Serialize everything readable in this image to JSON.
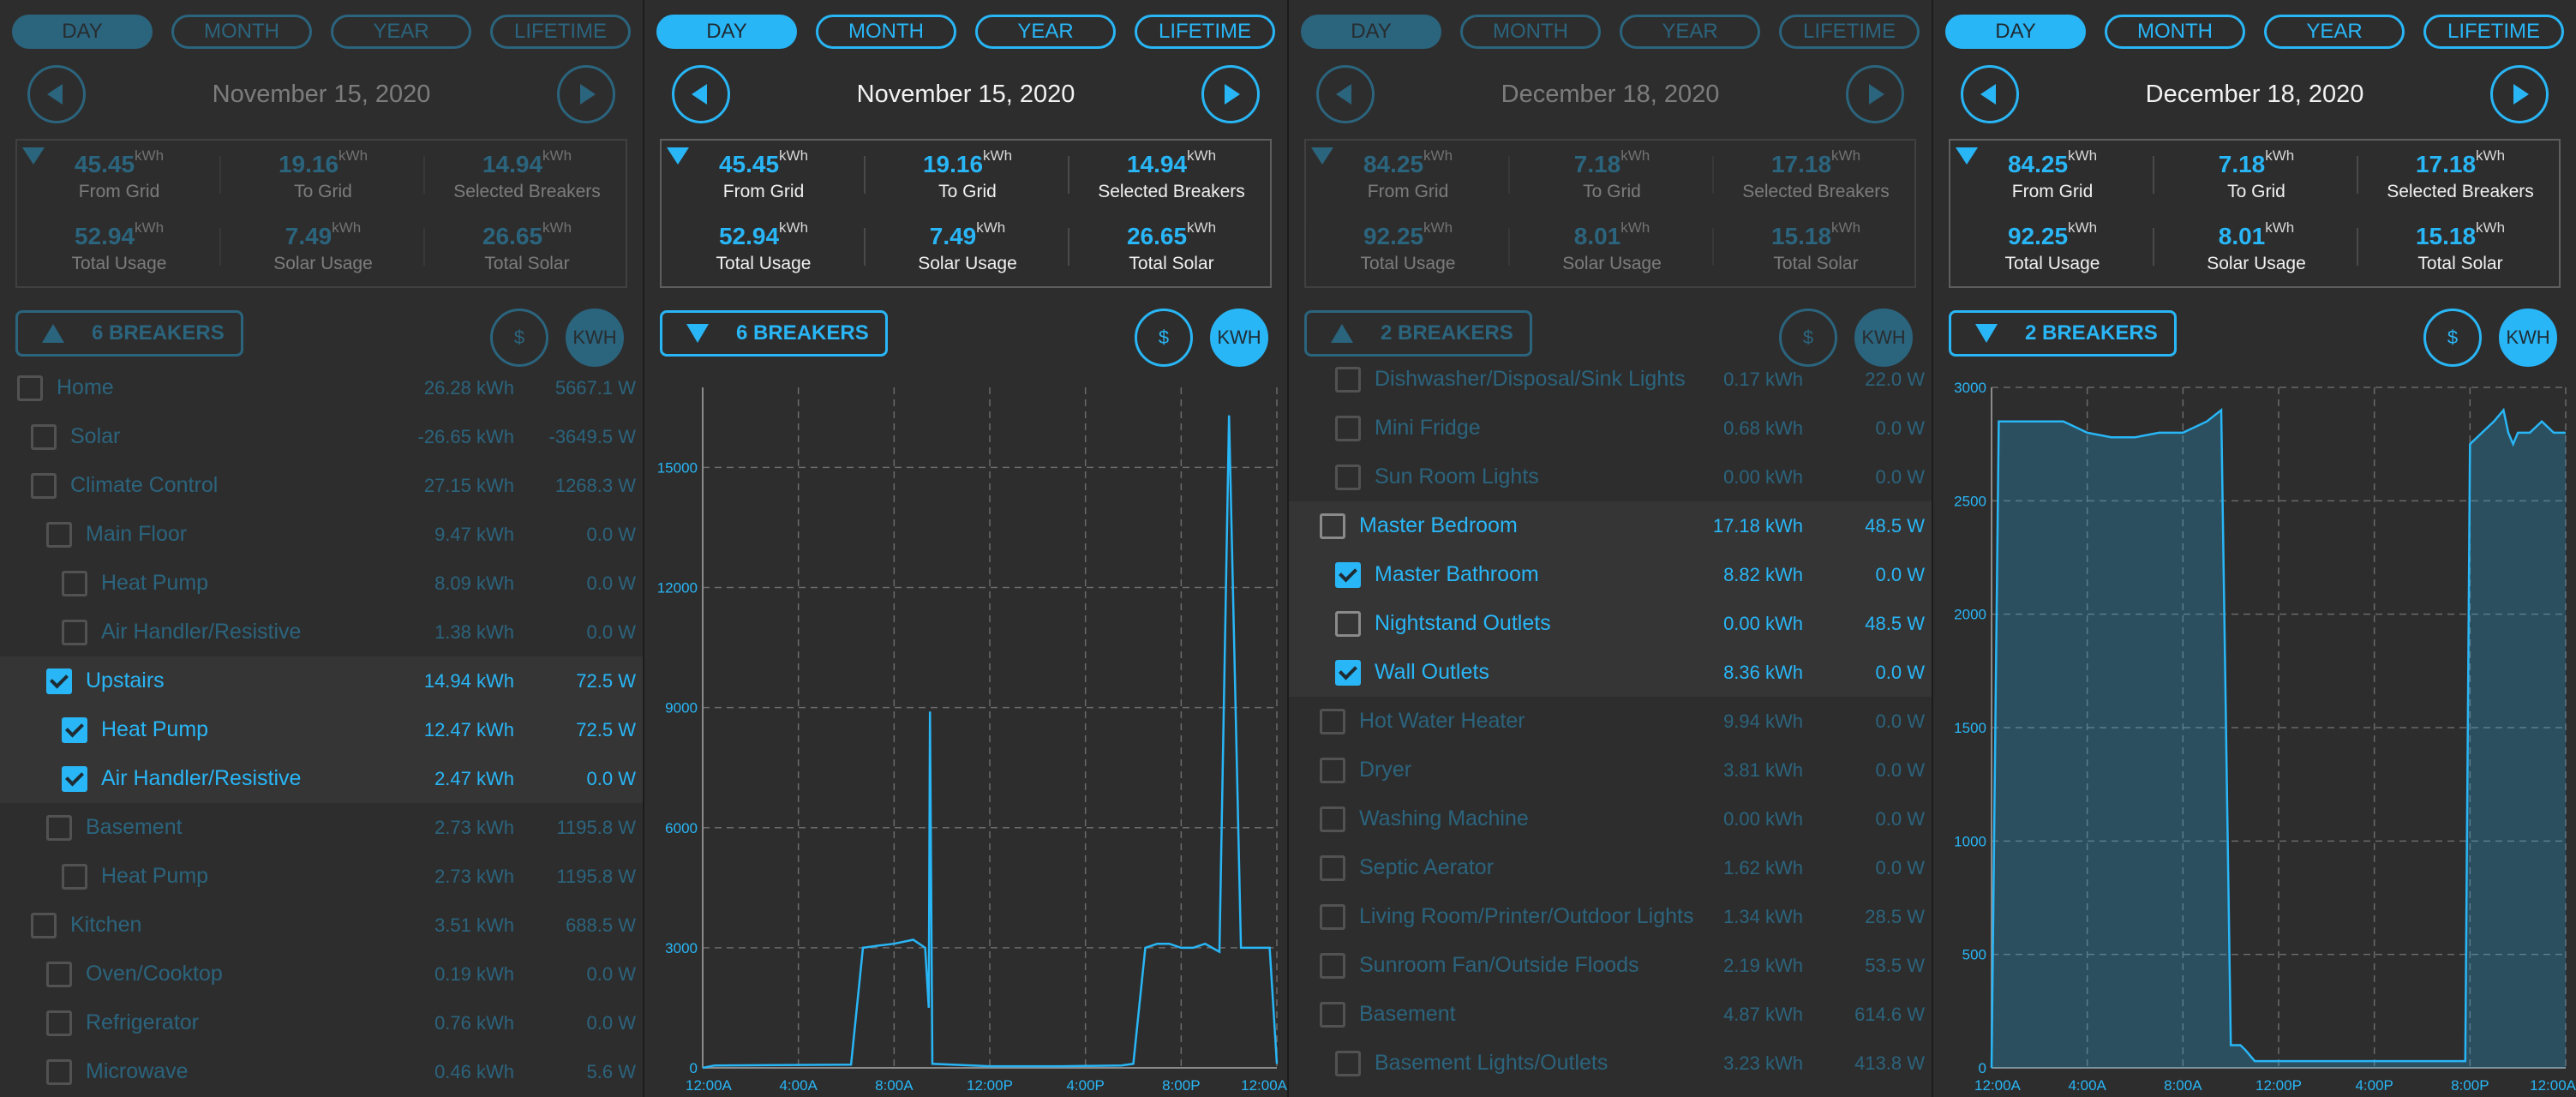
{
  "colors": {
    "accent": "#29b6f6",
    "background": "#2d2d2d",
    "text": "#f0f0f0"
  },
  "periods": [
    "DAY",
    "MONTH",
    "YEAR",
    "LIFETIME"
  ],
  "units": {
    "kwh": "kWh"
  },
  "buttons": {
    "usd": "$",
    "kwh": "KWH"
  },
  "panels": [
    {
      "date": "November 15, 2020",
      "breakers_label": "6 BREAKERS",
      "stats": [
        {
          "value": "45.45",
          "label": "From Grid"
        },
        {
          "value": "19.16",
          "label": "To Grid"
        },
        {
          "value": "14.94",
          "label": "Selected Breakers"
        },
        {
          "value": "52.94",
          "label": "Total Usage"
        },
        {
          "value": "7.49",
          "label": "Solar Usage"
        },
        {
          "value": "26.65",
          "label": "Total Solar"
        }
      ],
      "breakers": [
        {
          "name": "Home",
          "kwh": "26.28 kWh",
          "w": "5667.1 W",
          "level": 0,
          "checked": false,
          "selected": false
        },
        {
          "name": "Solar",
          "kwh": "-26.65 kWh",
          "w": "-3649.5 W",
          "level": 1,
          "checked": false,
          "selected": false
        },
        {
          "name": "Climate Control",
          "kwh": "27.15 kWh",
          "w": "1268.3 W",
          "level": 1,
          "checked": false,
          "selected": false
        },
        {
          "name": "Main Floor",
          "kwh": "9.47 kWh",
          "w": "0.0 W",
          "level": 2,
          "checked": false,
          "selected": false
        },
        {
          "name": "Heat Pump",
          "kwh": "8.09 kWh",
          "w": "0.0 W",
          "level": 3,
          "checked": false,
          "selected": false
        },
        {
          "name": "Air Handler/Resistive",
          "kwh": "1.38 kWh",
          "w": "0.0 W",
          "level": 3,
          "checked": false,
          "selected": false
        },
        {
          "name": "Upstairs",
          "kwh": "14.94 kWh",
          "w": "72.5 W",
          "level": 2,
          "checked": true,
          "selected": true
        },
        {
          "name": "Heat Pump",
          "kwh": "12.47 kWh",
          "w": "72.5 W",
          "level": 3,
          "checked": true,
          "selected": true
        },
        {
          "name": "Air Handler/Resistive",
          "kwh": "2.47 kWh",
          "w": "0.0 W",
          "level": 3,
          "checked": true,
          "selected": true
        },
        {
          "name": "Basement",
          "kwh": "2.73 kWh",
          "w": "1195.8 W",
          "level": 2,
          "checked": false,
          "selected": false
        },
        {
          "name": "Heat Pump",
          "kwh": "2.73 kWh",
          "w": "1195.8 W",
          "level": 3,
          "checked": false,
          "selected": false
        },
        {
          "name": "Kitchen",
          "kwh": "3.51 kWh",
          "w": "688.5 W",
          "level": 1,
          "checked": false,
          "selected": false
        },
        {
          "name": "Oven/Cooktop",
          "kwh": "0.19 kWh",
          "w": "0.0 W",
          "level": 2,
          "checked": false,
          "selected": false
        },
        {
          "name": "Refrigerator",
          "kwh": "0.76 kWh",
          "w": "0.0 W",
          "level": 2,
          "checked": false,
          "selected": false
        },
        {
          "name": "Microwave",
          "kwh": "0.46 kWh",
          "w": "5.6 W",
          "level": 2,
          "checked": false,
          "selected": false
        }
      ]
    },
    {
      "date": "November 15, 2020",
      "breakers_label": "6 BREAKERS",
      "stats": [
        {
          "value": "45.45",
          "label": "From Grid"
        },
        {
          "value": "19.16",
          "label": "To Grid"
        },
        {
          "value": "14.94",
          "label": "Selected Breakers"
        },
        {
          "value": "52.94",
          "label": "Total Usage"
        },
        {
          "value": "7.49",
          "label": "Solar Usage"
        },
        {
          "value": "26.65",
          "label": "Total Solar"
        }
      ]
    },
    {
      "date": "December 18, 2020",
      "breakers_label": "2 BREAKERS",
      "stats": [
        {
          "value": "84.25",
          "label": "From Grid"
        },
        {
          "value": "7.18",
          "label": "To Grid"
        },
        {
          "value": "17.18",
          "label": "Selected Breakers"
        },
        {
          "value": "92.25",
          "label": "Total Usage"
        },
        {
          "value": "8.01",
          "label": "Solar Usage"
        },
        {
          "value": "15.18",
          "label": "Total Solar"
        }
      ],
      "breakers": [
        {
          "name": "Dishwasher/Disposal/Sink Lights",
          "kwh": "0.17 kWh",
          "w": "22.0 W",
          "level": 2,
          "checked": false,
          "selected": false
        },
        {
          "name": "Mini Fridge",
          "kwh": "0.68 kWh",
          "w": "0.0 W",
          "level": 2,
          "checked": false,
          "selected": false
        },
        {
          "name": "Sun Room Lights",
          "kwh": "0.00 kWh",
          "w": "0.0 W",
          "level": 2,
          "checked": false,
          "selected": false
        },
        {
          "name": "Master Bedroom",
          "kwh": "17.18 kWh",
          "w": "48.5 W",
          "level": 1,
          "checked": false,
          "selected": true
        },
        {
          "name": "Master Bathroom",
          "kwh": "8.82 kWh",
          "w": "0.0 W",
          "level": 2,
          "checked": true,
          "selected": true
        },
        {
          "name": "Nightstand Outlets",
          "kwh": "0.00 kWh",
          "w": "48.5 W",
          "level": 2,
          "checked": false,
          "selected": true
        },
        {
          "name": "Wall Outlets",
          "kwh": "8.36 kWh",
          "w": "0.0 W",
          "level": 2,
          "checked": true,
          "selected": true
        },
        {
          "name": "Hot Water Heater",
          "kwh": "9.94 kWh",
          "w": "0.0 W",
          "level": 1,
          "checked": false,
          "selected": false
        },
        {
          "name": "Dryer",
          "kwh": "3.81 kWh",
          "w": "0.0 W",
          "level": 1,
          "checked": false,
          "selected": false
        },
        {
          "name": "Washing Machine",
          "kwh": "0.00 kWh",
          "w": "0.0 W",
          "level": 1,
          "checked": false,
          "selected": false
        },
        {
          "name": "Septic Aerator",
          "kwh": "1.62 kWh",
          "w": "0.0 W",
          "level": 1,
          "checked": false,
          "selected": false
        },
        {
          "name": "Living Room/Printer/Outdoor Lights",
          "kwh": "1.34 kWh",
          "w": "28.5 W",
          "level": 1,
          "checked": false,
          "selected": false
        },
        {
          "name": "Sunroom Fan/Outside Floods",
          "kwh": "2.19 kWh",
          "w": "53.5 W",
          "level": 1,
          "checked": false,
          "selected": false
        },
        {
          "name": "Basement",
          "kwh": "4.87 kWh",
          "w": "614.6 W",
          "level": 1,
          "checked": false,
          "selected": false
        },
        {
          "name": "Basement Lights/Outlets",
          "kwh": "3.23 kWh",
          "w": "413.8 W",
          "level": 2,
          "checked": false,
          "selected": false
        }
      ]
    },
    {
      "date": "December 18, 2020",
      "breakers_label": "2 BREAKERS",
      "stats": [
        {
          "value": "84.25",
          "label": "From Grid"
        },
        {
          "value": "7.18",
          "label": "To Grid"
        },
        {
          "value": "17.18",
          "label": "Selected Breakers"
        },
        {
          "value": "92.25",
          "label": "Total Usage"
        },
        {
          "value": "8.01",
          "label": "Solar Usage"
        },
        {
          "value": "15.18",
          "label": "Total Solar"
        }
      ]
    }
  ],
  "chart_data": [
    {
      "type": "line",
      "xlabel": "",
      "ylabel": "",
      "x_ticks": [
        "12:00A",
        "4:00A",
        "8:00A",
        "12:00P",
        "4:00P",
        "8:00P",
        "12:00A"
      ],
      "y_ticks": [
        0,
        3000,
        6000,
        9000,
        12000,
        15000
      ],
      "ylim": [
        0,
        17000
      ],
      "xlim_hours": [
        0,
        24
      ],
      "grid": true,
      "series": [
        {
          "x_hours": [
            0,
            0.5,
            6.2,
            6.7,
            7.3,
            8,
            8.8,
            9.3,
            9.45,
            9.5,
            9.6,
            12,
            15,
            17.5,
            18,
            18.5,
            19,
            19.5,
            20,
            20.5,
            21,
            21.3,
            21.6,
            22,
            22.5,
            23,
            23.7,
            24
          ],
          "y": [
            0,
            60,
            80,
            3000,
            3050,
            3100,
            3200,
            3000,
            1500,
            8900,
            100,
            40,
            40,
            60,
            100,
            3000,
            3100,
            3100,
            3000,
            3000,
            3100,
            3000,
            2900,
            16300,
            3000,
            3000,
            3000,
            100
          ]
        }
      ]
    },
    {
      "type": "area",
      "xlabel": "",
      "ylabel": "",
      "x_ticks": [
        "12:00A",
        "4:00A",
        "8:00A",
        "12:00P",
        "4:00P",
        "8:00P",
        "12:00A"
      ],
      "y_ticks": [
        0,
        500,
        1000,
        1500,
        2000,
        2500,
        3000
      ],
      "ylim": [
        0,
        3000
      ],
      "xlim_hours": [
        0,
        24
      ],
      "grid": true,
      "series": [
        {
          "x_hours": [
            0,
            0.3,
            1,
            2,
            3,
            4,
            5,
            6,
            7,
            8,
            9,
            9.6,
            10,
            10.4,
            10.6,
            11,
            12,
            13,
            14,
            15,
            16,
            17,
            18,
            19.8,
            20,
            20.5,
            21,
            21.4,
            21.6,
            21.8,
            22,
            22.5,
            23,
            23.5,
            24
          ],
          "y": [
            0,
            2850,
            2850,
            2850,
            2850,
            2800,
            2780,
            2780,
            2800,
            2800,
            2850,
            2900,
            100,
            100,
            80,
            30,
            30,
            30,
            30,
            30,
            30,
            30,
            30,
            30,
            2750,
            2800,
            2850,
            2900,
            2800,
            2750,
            2800,
            2800,
            2850,
            2800,
            2800
          ]
        }
      ]
    }
  ]
}
